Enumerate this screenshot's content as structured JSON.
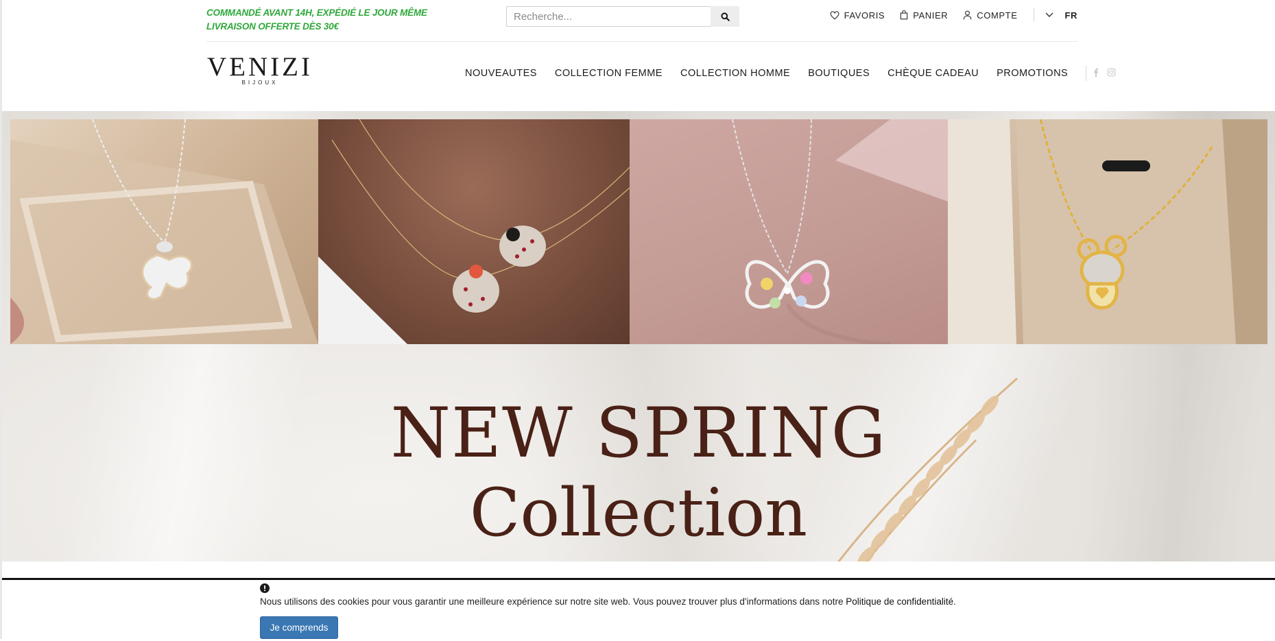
{
  "topbar": {
    "promo_line1": "COMMANDÉ AVANT 14H, EXPÉDIÉ LE JOUR MÊME",
    "promo_line2": "LIVRAISON OFFERTE DÈS 30€",
    "search_placeholder": "Recherche...",
    "search_icon": "search-icon",
    "favorites_label": "FAVORIS",
    "cart_label": "PANIER",
    "account_label": "COMPTE",
    "language": "FR"
  },
  "brand": {
    "name": "VENIZI",
    "tagline": "BIJOUX"
  },
  "nav": {
    "items": [
      "NOUVEAUTES",
      "COLLECTION FEMME",
      "COLLECTION HOMME",
      "BOUTIQUES",
      "CHÈQUE CADEAU",
      "PROMOTIONS"
    ],
    "social_icons": [
      "facebook-icon",
      "instagram-icon"
    ]
  },
  "hero": {
    "headline_line1": "NEW SPRING",
    "headline_line2": "Collection",
    "text_color": "#4a2116",
    "products": [
      "silver-butterfly-necklace",
      "ladybug-necklace",
      "pastel-butterfly-necklace",
      "gold-teddy-bear-necklace"
    ]
  },
  "cookie_banner": {
    "message_prefix": "Nous utilisons des cookies pour vous garantir une meilleure expérience sur notre site web. Vous pouvez trouver plus d'informations dans notre ",
    "policy_link": "Politique de confidentialité",
    "message_suffix": ".",
    "accept_button": "Je comprends",
    "button_color": "#3a77b3"
  },
  "colors": {
    "promo_green": "#2ea83a"
  }
}
